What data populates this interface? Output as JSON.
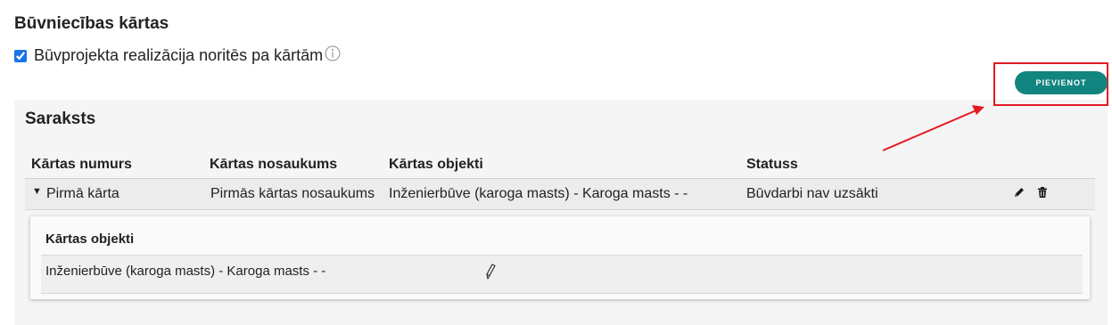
{
  "page": {
    "title": "Būvniecības kārtas"
  },
  "stages_option": {
    "label": "Būvprojekta realizācija noritēs pa kārtām",
    "checked": true
  },
  "toolbar": {
    "add_label": "PIEVIENOT"
  },
  "list": {
    "title": "Saraksts",
    "columns": [
      "Kārtas numurs",
      "Kārtas nosaukums",
      "Kārtas objekti",
      "Statuss"
    ],
    "rows": [
      {
        "number": "Pirmā kārta",
        "name": "Pirmās kārtas nosaukums",
        "objects": "Inženierbūve (karoga masts) - Karoga masts - -",
        "status": "Būvdarbi nav uzsākti"
      }
    ]
  },
  "objects_panel": {
    "title": "Kārtas objekti",
    "items": [
      "Inženierbūve (karoga masts) - Karoga masts - -"
    ]
  },
  "colors": {
    "accent": "#11857f",
    "annotation": "#e31b23",
    "panel_bg": "#f5f5f5"
  },
  "icons": [
    "info-icon",
    "caret-down-icon",
    "pencil-icon",
    "trash-icon",
    "pencil-outline-icon"
  ]
}
